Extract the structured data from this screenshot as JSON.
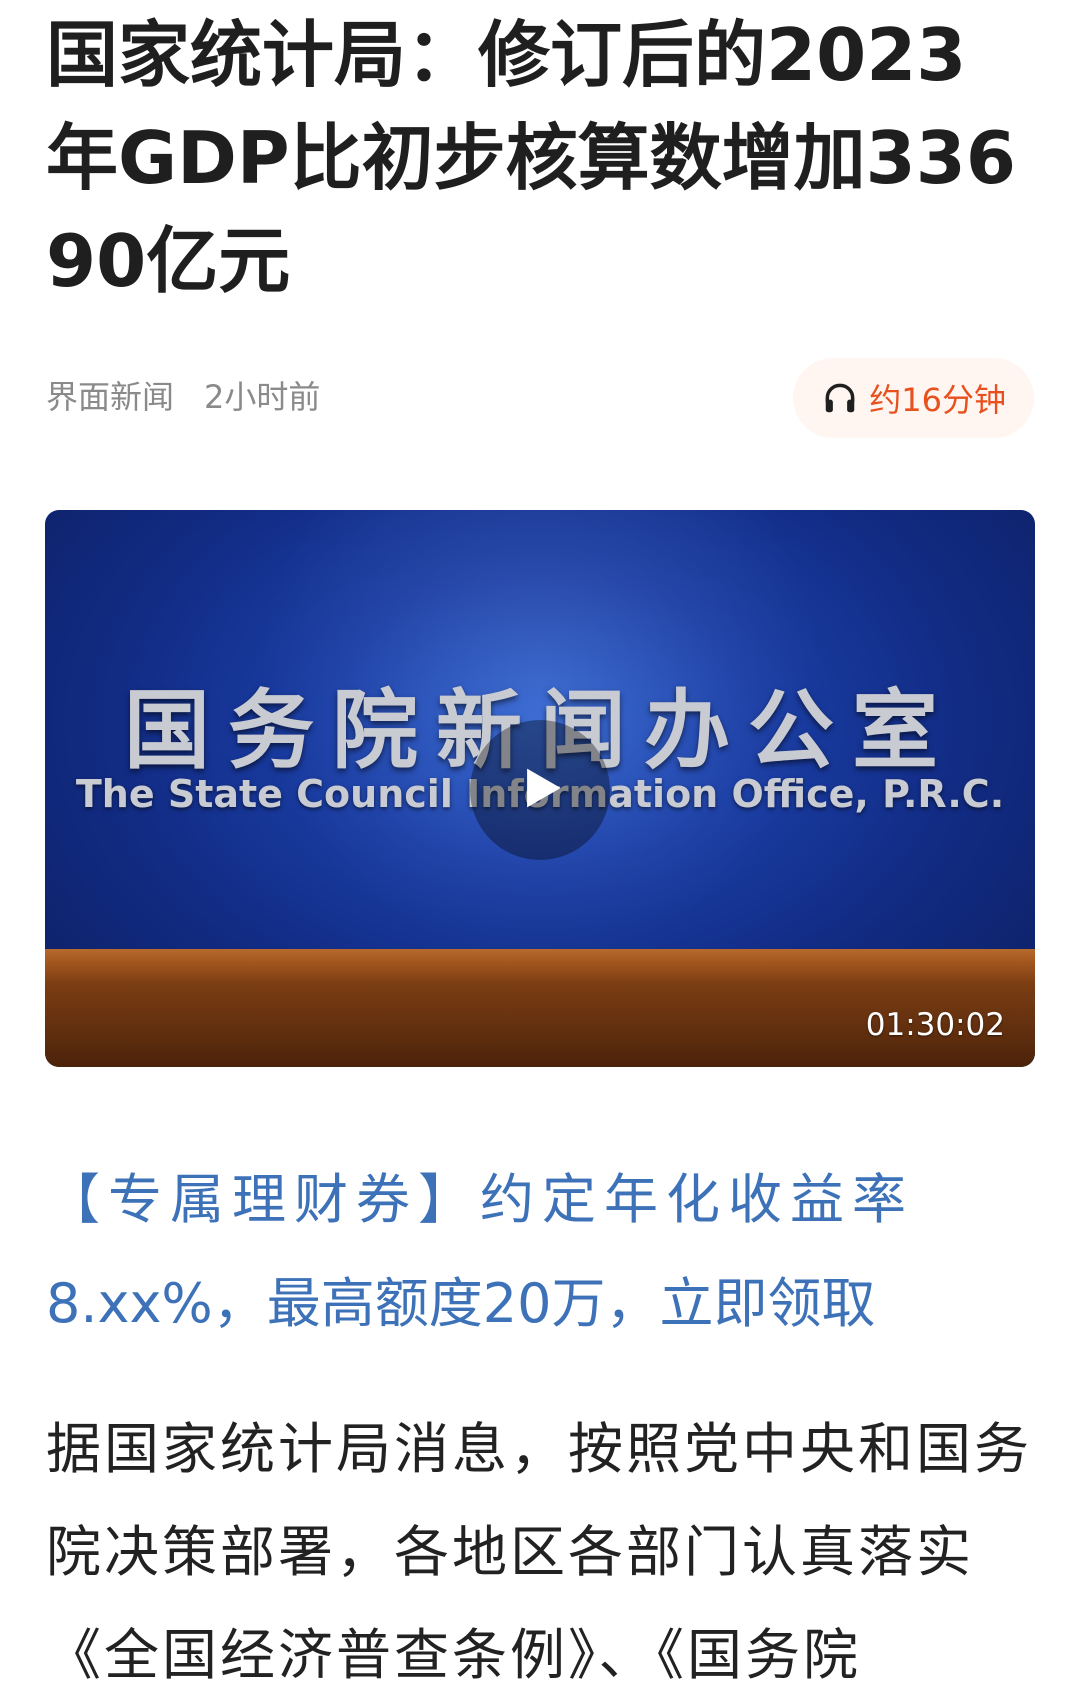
{
  "article": {
    "title": "国家统计局：修订后的2023年GDP比初步核算数增加33690亿元",
    "source": "界面新闻",
    "time": "2小时前",
    "listen_label": "约16分钟"
  },
  "video": {
    "cn_title": "国务院新闻办公室",
    "en_title": "The State Council Information Office, P.R.C.",
    "duration": "01:30:02"
  },
  "ad": {
    "line1": "【专属理财券】约定年化收益率",
    "line2": "8.xx%，最高额度20万，立即领取"
  },
  "body": {
    "paragraph": "据国家统计局消息，按照党中央和国务院决策部署，各地区各部门认真落实《全国经济普查条例》、《国务院"
  },
  "icons": {
    "listen": "headphones-icon",
    "play": "play-icon"
  },
  "colors": {
    "accent": "#e8501e",
    "link": "#3d72b8",
    "video_bg": "#1a3ea6"
  }
}
